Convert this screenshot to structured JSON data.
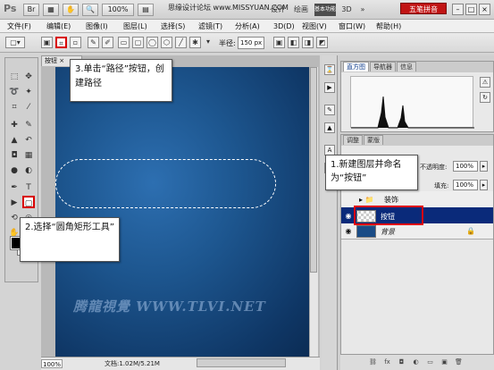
{
  "appbar": {
    "logo": "Ps",
    "zoom": "100%",
    "workspaces": [
      "设计",
      "绘画",
      "基本功能",
      "3D"
    ],
    "active_workspace": "基本功能",
    "site_watermark": "思缘设计论坛  www.MISSYUAN.COM",
    "site_badge": "五笔拼音",
    "window_controls": [
      "minimize",
      "maximize",
      "close"
    ]
  },
  "menubar": {
    "items": [
      "文件(F)",
      "编辑(E)",
      "图像(I)",
      "图层(L)",
      "选择(S)",
      "滤镜(T)",
      "分析(A)",
      "3D(D)",
      "视图(V)",
      "窗口(W)",
      "帮助(H)"
    ]
  },
  "options_bar": {
    "radius_label": "半径:",
    "radius_value": "150 px"
  },
  "document": {
    "tab_title": "按钮",
    "watermark": "腾龍視覺 WWW.TLVI.NET",
    "zoom": "100%",
    "doc_info": "文档:1.02M/5.21M"
  },
  "panels": {
    "top_tabs": [
      "直方图",
      "导航器",
      "信息"
    ],
    "layer_tabs": [
      "调整",
      "蒙版"
    ],
    "opacity_label": "不透明度:",
    "opacity_value": "100%",
    "fill_label": "填充:",
    "fill_value": "100%",
    "layers": [
      {
        "name": "装饰",
        "type": "group"
      },
      {
        "name": "按钮",
        "type": "layer",
        "selected": true
      },
      {
        "name": "背景",
        "type": "background",
        "locked": true
      }
    ]
  },
  "callouts": {
    "step1": "1.新建图层并命名为“按钮”",
    "step2": "2.选择“圆角矩形工具”",
    "step3": "3.单击“路径”按钮，创建路径"
  },
  "colors": {
    "highlight": "#e00000",
    "canvas_blue": "#1d568f",
    "selected_layer": "#0a2a7a"
  }
}
